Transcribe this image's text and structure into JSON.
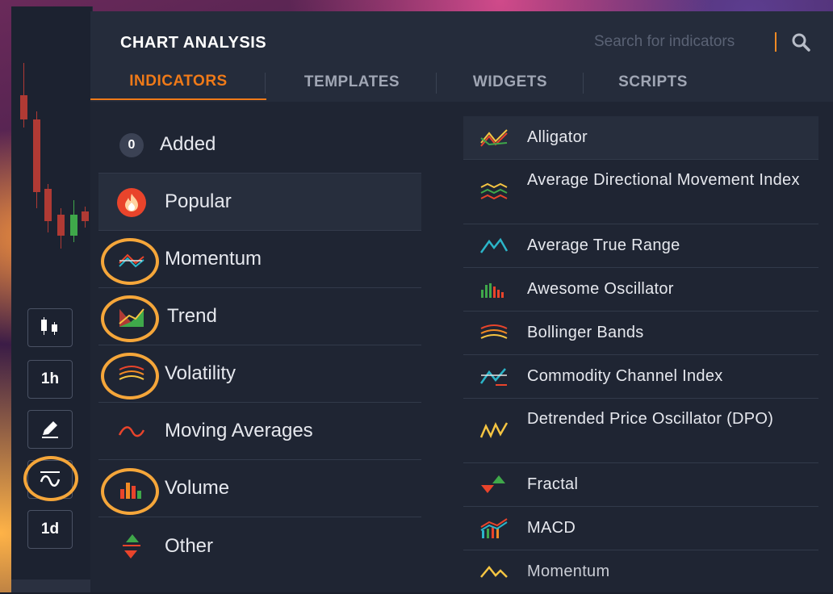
{
  "panel": {
    "title": "CHART ANALYSIS",
    "search": {
      "placeholder": "Search for indicators",
      "value": ""
    }
  },
  "tabs": [
    {
      "label": "INDICATORS",
      "active": true
    },
    {
      "label": "TEMPLATES",
      "active": false
    },
    {
      "label": "WIDGETS",
      "active": false
    },
    {
      "label": "SCRIPTS",
      "active": false
    }
  ],
  "categories": [
    {
      "label": "Added",
      "badge": "0",
      "icon": "count-badge"
    },
    {
      "label": "Popular",
      "icon": "fire-icon",
      "selected": true
    },
    {
      "label": "Momentum",
      "icon": "momentum-icon"
    },
    {
      "label": "Trend",
      "icon": "trend-icon"
    },
    {
      "label": "Volatility",
      "icon": "volatility-icon"
    },
    {
      "label": "Moving Averages",
      "icon": "moving-averages-icon"
    },
    {
      "label": "Volume",
      "icon": "volume-icon"
    },
    {
      "label": "Other",
      "icon": "other-icon"
    }
  ],
  "indicators": [
    {
      "label": "Alligator",
      "icon": "alligator-icon"
    },
    {
      "label": "Average Directional Movement Index",
      "icon": "adx-icon"
    },
    {
      "label": "Average True Range",
      "icon": "atr-icon"
    },
    {
      "label": "Awesome Oscillator",
      "icon": "awesome-oscillator-icon"
    },
    {
      "label": "Bollinger Bands",
      "icon": "bollinger-icon"
    },
    {
      "label": "Commodity Channel Index",
      "icon": "cci-icon"
    },
    {
      "label": "Detrended Price Oscillator (DPO)",
      "icon": "dpo-icon"
    },
    {
      "label": "Fractal",
      "icon": "fractal-icon"
    },
    {
      "label": "MACD",
      "icon": "macd-icon"
    },
    {
      "label": "Momentum",
      "icon": "momentum-line-icon"
    }
  ],
  "toolbar": {
    "chart_type_icon": "candles-icon",
    "timeframe": "1h",
    "draw_icon": "pencil-icon",
    "indicators_icon": "indicators-icon",
    "period": "1d"
  },
  "colors": {
    "accent": "#f07a18",
    "highlight_ring": "#f5a63a",
    "panel_bg": "#1f2533",
    "header_bg": "#252c3b"
  }
}
